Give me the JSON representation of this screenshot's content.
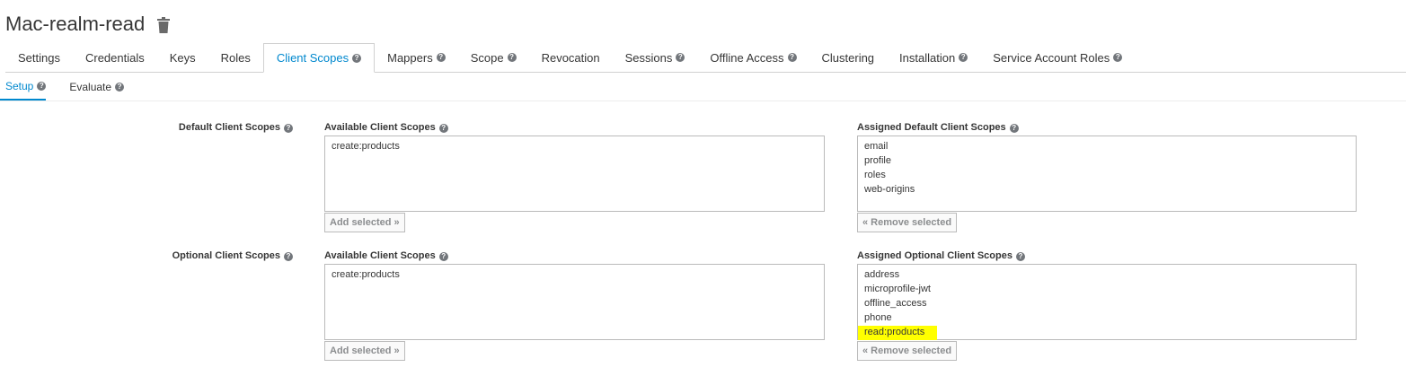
{
  "header": {
    "title": "Mac-realm-read",
    "delete_icon": "trash-icon"
  },
  "tabs": [
    {
      "label": "Settings",
      "help": false
    },
    {
      "label": "Credentials",
      "help": false
    },
    {
      "label": "Keys",
      "help": false
    },
    {
      "label": "Roles",
      "help": false
    },
    {
      "label": "Client Scopes",
      "help": true,
      "active": true
    },
    {
      "label": "Mappers",
      "help": true
    },
    {
      "label": "Scope",
      "help": true
    },
    {
      "label": "Revocation",
      "help": false
    },
    {
      "label": "Sessions",
      "help": true
    },
    {
      "label": "Offline Access",
      "help": true
    },
    {
      "label": "Clustering",
      "help": false
    },
    {
      "label": "Installation",
      "help": true
    },
    {
      "label": "Service Account Roles",
      "help": true
    }
  ],
  "subtabs": [
    {
      "label": "Setup",
      "active": true
    },
    {
      "label": "Evaluate",
      "active": false
    }
  ],
  "help_glyph": "?",
  "default_scopes": {
    "row_label": "Default Client Scopes",
    "available_label": "Available Client Scopes",
    "available": [
      "create:products"
    ],
    "add_button": "Add selected »",
    "assigned_label": "Assigned Default Client Scopes",
    "assigned": [
      "email",
      "profile",
      "roles",
      "web-origins"
    ],
    "remove_button": "« Remove selected"
  },
  "optional_scopes": {
    "row_label": "Optional Client Scopes",
    "available_label": "Available Client Scopes",
    "available": [
      "create:products"
    ],
    "add_button": "Add selected »",
    "assigned_label": "Assigned Optional Client Scopes",
    "assigned": [
      "address",
      "microprofile-jwt",
      "offline_access",
      "phone",
      "read:products"
    ],
    "remove_button": "« Remove selected",
    "highlight_color": "#ffff00"
  },
  "colors": {
    "accent": "#0088ce",
    "text": "#363636",
    "help_icon": "#72767b"
  }
}
